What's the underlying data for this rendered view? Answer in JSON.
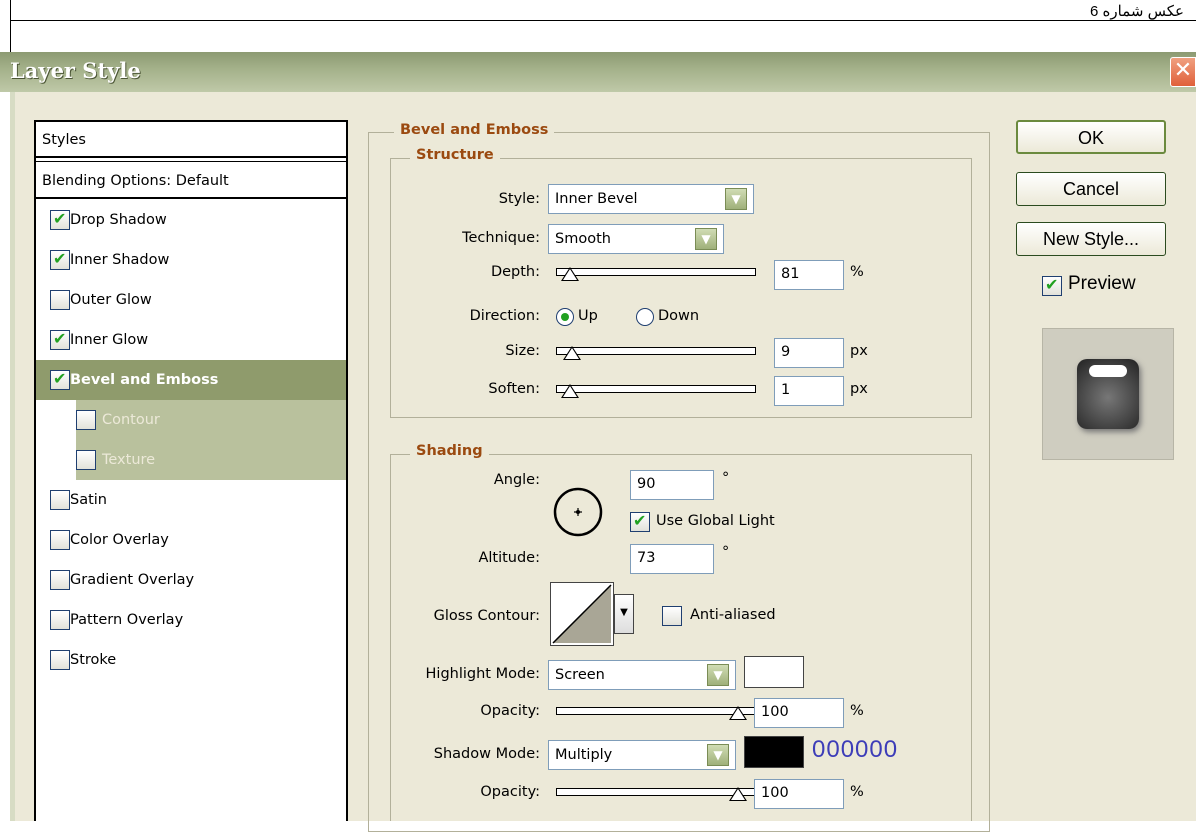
{
  "doc_caption": "عکس شماره 6",
  "window": {
    "title": "Layer Style",
    "close_glyph": "✕"
  },
  "styles_panel": {
    "header": "Styles",
    "blending": "Blending Options: Default",
    "items": [
      {
        "label": "Drop Shadow",
        "checked": true
      },
      {
        "label": "Inner Shadow",
        "checked": true
      },
      {
        "label": "Outer Glow",
        "checked": false
      },
      {
        "label": "Inner Glow",
        "checked": true
      },
      {
        "label": "Bevel and Emboss",
        "checked": true,
        "selected": true
      },
      {
        "label": "Contour",
        "checked": false,
        "sub": true
      },
      {
        "label": "Texture",
        "checked": false,
        "sub": true
      },
      {
        "label": "Satin",
        "checked": false
      },
      {
        "label": "Color Overlay",
        "checked": false
      },
      {
        "label": "Gradient Overlay",
        "checked": false
      },
      {
        "label": "Pattern Overlay",
        "checked": false
      },
      {
        "label": "Stroke",
        "checked": false
      }
    ]
  },
  "bevel": {
    "legend": "Bevel and Emboss",
    "structure": {
      "legend": "Structure",
      "style_label": "Style:",
      "style_value": "Inner Bevel",
      "technique_label": "Technique:",
      "technique_value": "Smooth",
      "depth_label": "Depth:",
      "depth_value": "81",
      "depth_unit": "%",
      "direction_label": "Direction:",
      "direction_up": "Up",
      "direction_down": "Down",
      "size_label": "Size:",
      "size_value": "9",
      "size_unit": "px",
      "soften_label": "Soften:",
      "soften_value": "1",
      "soften_unit": "px"
    },
    "shading": {
      "legend": "Shading",
      "angle_label": "Angle:",
      "angle_value": "90",
      "angle_unit": "°",
      "use_global_light": "Use Global Light",
      "altitude_label": "Altitude:",
      "altitude_value": "73",
      "altitude_unit": "°",
      "gloss_label": "Gloss Contour:",
      "anti_aliased": "Anti-aliased",
      "highlight_label": "Highlight Mode:",
      "highlight_value": "Screen",
      "opacity_label": "Opacity:",
      "opacity1_value": "100",
      "opacity_unit": "%",
      "shadow_label": "Shadow Mode:",
      "shadow_value": "Multiply",
      "shadow_color_hex": "000000",
      "opacity2_value": "100"
    }
  },
  "buttons": {
    "ok": "OK",
    "cancel": "Cancel",
    "new_style": "New Style...",
    "preview": "Preview"
  },
  "colors": {
    "titlebar": "#a3b089",
    "selected_row": "#8f9b6c",
    "legend_text": "#9b4a10",
    "highlight_swatch": "#ffffff",
    "shadow_swatch": "#000000",
    "hex_text": "#3d3db8"
  }
}
